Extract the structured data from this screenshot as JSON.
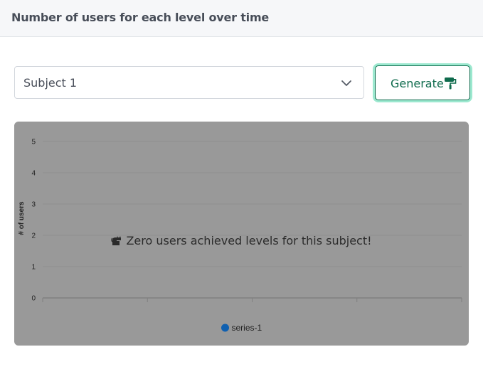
{
  "card": {
    "title": "Number of users for each level over time"
  },
  "subject_select": {
    "selected": "Subject 1",
    "icon": "chevron-down-icon"
  },
  "generate_button": {
    "label": "Generate",
    "icon": "paint-roller-icon",
    "border_color": "#0f6b4d",
    "focus_ring_color": "#9ce8cf"
  },
  "empty_state": {
    "message": "Zero users achieved levels for this subject!",
    "icon": "cat-icon"
  },
  "chart_data": {
    "type": "line",
    "title": "",
    "ylabel": "# of users",
    "xlabel": "",
    "ylim": [
      0,
      5
    ],
    "y_ticks": [
      "0",
      "1",
      "2",
      "3",
      "4",
      "5"
    ],
    "x_tick_count": 5,
    "grid": true,
    "legend_position": "bottom-center",
    "background_color": "#999999",
    "series": [
      {
        "name": "series-1",
        "color": "#1060b0",
        "values": []
      }
    ]
  }
}
